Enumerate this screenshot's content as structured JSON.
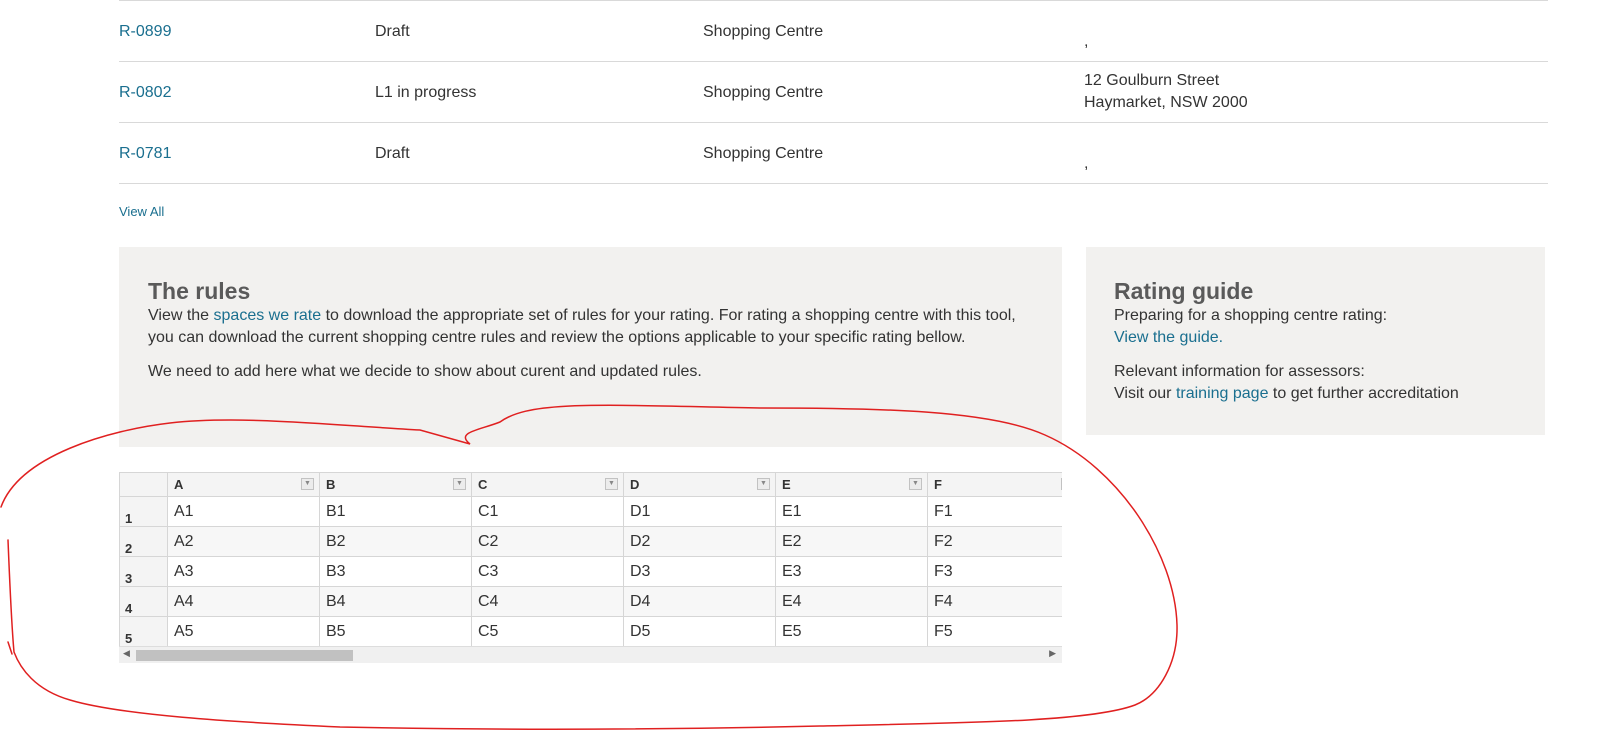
{
  "ratings": {
    "rows": [
      {
        "id": "R-0899",
        "status": "Draft",
        "type": "Shopping Centre",
        "address": ","
      },
      {
        "id": "R-0802",
        "status": "L1 in progress",
        "type": "Shopping Centre",
        "address": "12 Goulburn Street\nHaymarket, NSW 2000"
      },
      {
        "id": "R-0781",
        "status": "Draft",
        "type": "Shopping Centre",
        "address": ","
      }
    ],
    "view_all": "View All"
  },
  "rules": {
    "title": "The rules",
    "p1_before": "View the ",
    "p1_link": "spaces we rate",
    "p1_after": " to download the appropriate set of rules for your rating. For rating a shopping centre with this tool, you can download the current shopping centre rules and review the options applicable to your specific rating bellow.",
    "p2": "We need to add here what we decide to show about curent and updated rules."
  },
  "guide": {
    "title": "Rating guide",
    "p1_text": "Preparing for a shopping centre rating:",
    "p1_link": "View the guide.",
    "p2_text": "Relevant information for assessors:",
    "p2_before": "Visit our ",
    "p2_link": "training page",
    "p2_after": " to get further accreditation"
  },
  "sheet": {
    "columns": [
      "A",
      "B",
      "C",
      "D",
      "E",
      "F"
    ],
    "rows": [
      {
        "num": "1",
        "cells": [
          "A1",
          "B1",
          "C1",
          "D1",
          "E1",
          "F1"
        ]
      },
      {
        "num": "2",
        "cells": [
          "A2",
          "B2",
          "C2",
          "D2",
          "E2",
          "F2"
        ]
      },
      {
        "num": "3",
        "cells": [
          "A3",
          "B3",
          "C3",
          "D3",
          "E3",
          "F3"
        ]
      },
      {
        "num": "4",
        "cells": [
          "A4",
          "B4",
          "C4",
          "D4",
          "E4",
          "F4"
        ]
      },
      {
        "num": "5",
        "cells": [
          "A5",
          "B5",
          "C5",
          "D5",
          "E5",
          "F5"
        ]
      }
    ],
    "filter_icon": "filter-dropdown-icon"
  },
  "colors": {
    "link": "#1a6f8f",
    "panel_bg": "#f2f1ef",
    "annotation": "#e02020"
  }
}
